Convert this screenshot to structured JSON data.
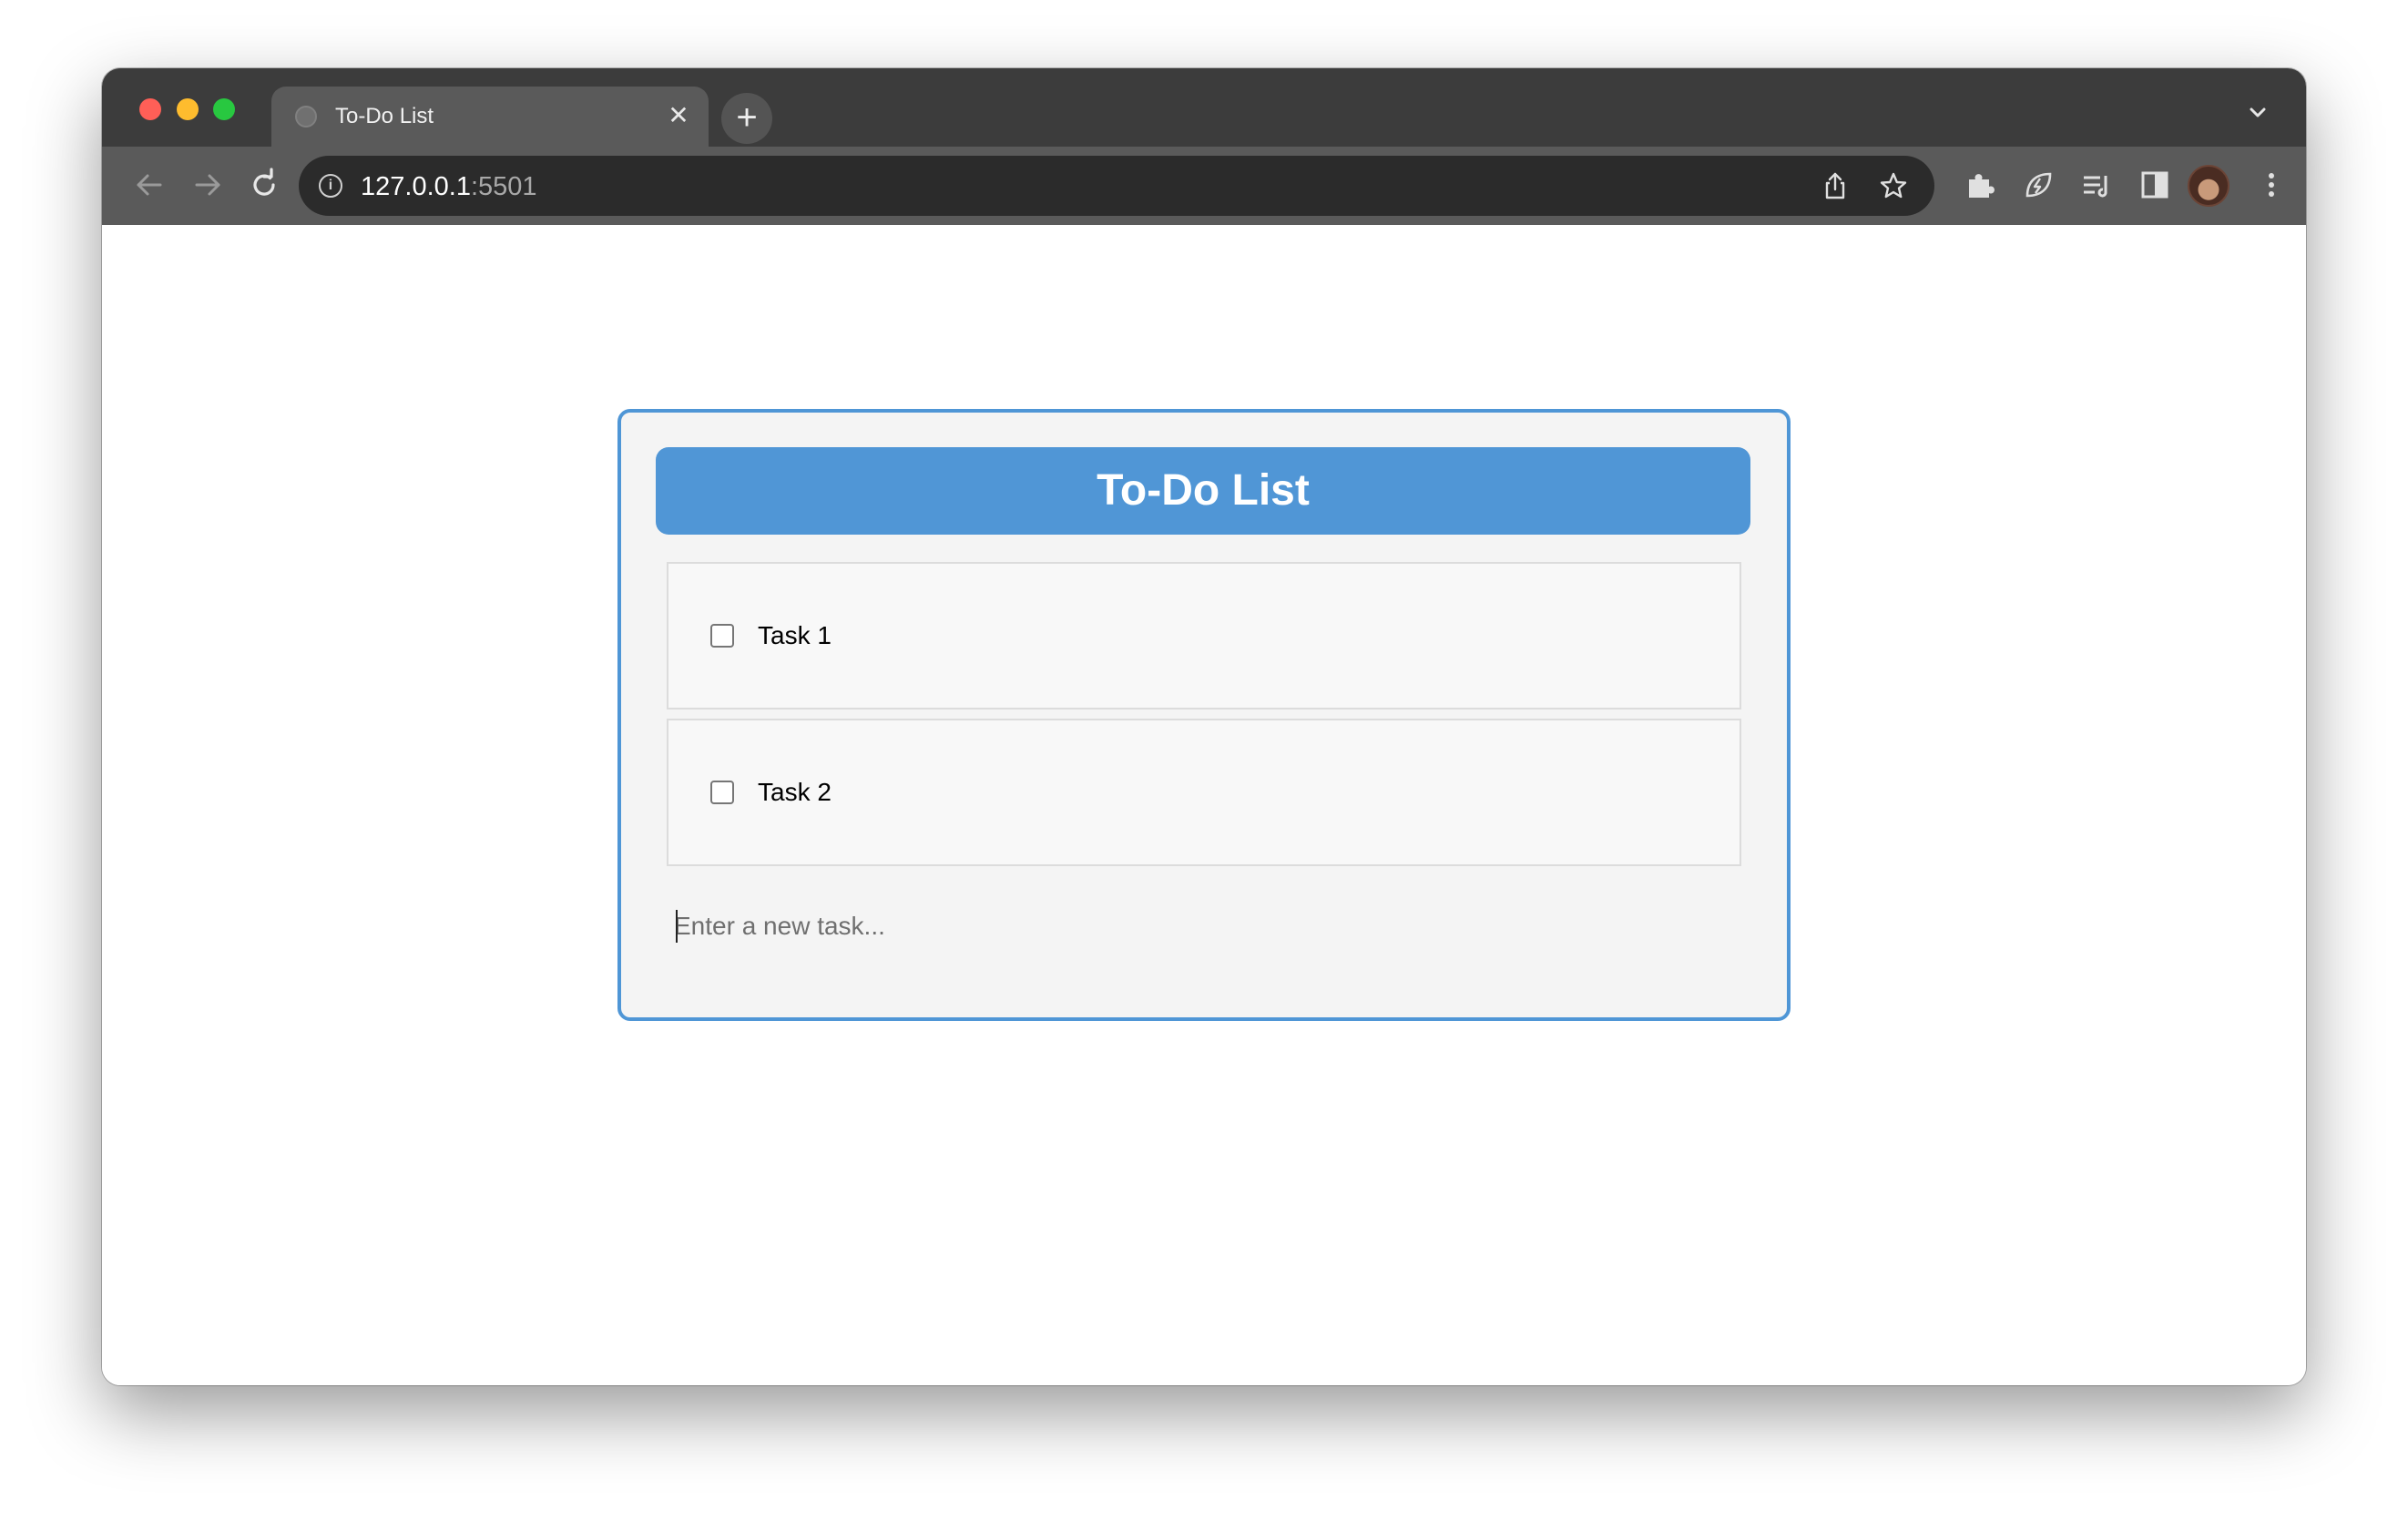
{
  "browser": {
    "tab": {
      "title": "To-Do List",
      "close_glyph": "✕"
    },
    "new_tab_glyph": "+",
    "address": {
      "host": "127.0.0.1",
      "port": ":5501"
    },
    "icons": {
      "favicon": "globe-icon",
      "back": "arrow-left-icon",
      "forward": "arrow-right-icon",
      "reload": "reload-icon",
      "site_info": "info-icon",
      "share": "share-icon",
      "bookmark": "star-icon",
      "extensions": "puzzle-icon",
      "extension": "leaf-bolt-icon",
      "reading_list": "reading-list-icon",
      "side_panel": "side-panel-icon",
      "menu": "vertical-dots-icon",
      "tab_list": "chevron-down-icon"
    }
  },
  "app": {
    "title": "To-Do List",
    "tasks": [
      {
        "label": "Task 1",
        "checked": false
      },
      {
        "label": "Task 2",
        "checked": false
      }
    ],
    "new_task_placeholder": "Enter a new task...",
    "colors": {
      "accent": "#5096d6",
      "border": "#4f96d6",
      "panel_background": "#f4f4f4",
      "task_background": "#f8f8f8"
    }
  }
}
